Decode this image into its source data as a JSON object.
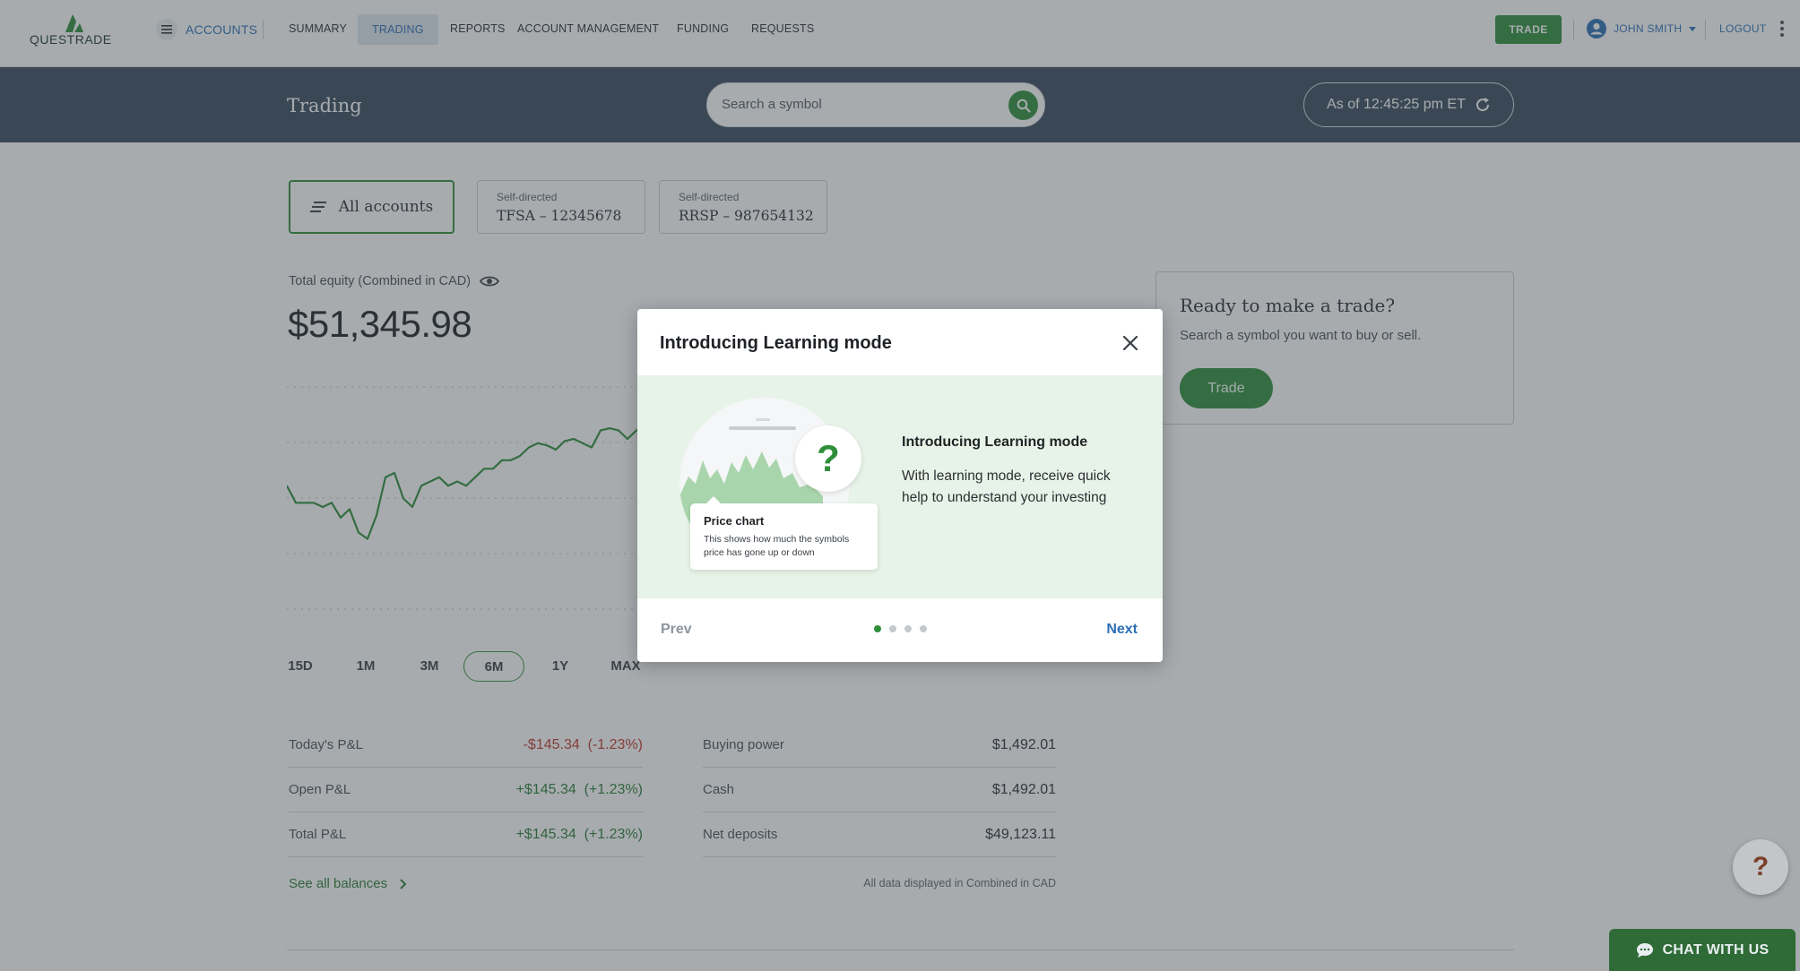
{
  "brand": {
    "logo_text": "QUESTRADE",
    "accent": "#2f8f3a",
    "link": "#2d6fb5",
    "header_bg": "#3a4b5d"
  },
  "nav": {
    "accounts": "ACCOUNTS",
    "items": [
      {
        "label": "SUMMARY"
      },
      {
        "label": "TRADING"
      },
      {
        "label": "REPORTS"
      },
      {
        "label": "ACCOUNT MANAGEMENT"
      },
      {
        "label": "FUNDING"
      },
      {
        "label": "REQUESTS"
      }
    ],
    "trade": "TRADE",
    "user": "JOHN SMITH",
    "logout": "LOGOUT"
  },
  "header": {
    "title": "Trading",
    "search_placeholder": "Search a symbol",
    "as_of": "As of 12:45:25 pm ET"
  },
  "accounts": {
    "all": "All accounts",
    "list": [
      {
        "type": "Self-directed",
        "name": "TFSA – 12345678"
      },
      {
        "type": "Self-directed",
        "name": "RRSP – 987654132"
      }
    ]
  },
  "equity": {
    "label": "Total equity (Combined in CAD)",
    "value": "$51,345.98"
  },
  "chart_data": {
    "type": "line",
    "values": [
      58,
      50,
      50,
      50,
      48,
      50,
      43,
      47,
      36,
      33,
      44,
      62,
      64,
      52,
      48,
      58,
      60,
      62,
      58,
      60,
      58,
      62,
      66,
      66,
      70,
      70,
      72,
      76,
      78,
      77,
      75,
      79,
      80,
      78,
      76,
      84,
      85,
      84,
      80,
      84,
      87,
      82,
      80
    ]
  },
  "ranges": [
    "15D",
    "1M",
    "3M",
    "6M",
    "1Y",
    "MAX"
  ],
  "pnl": [
    {
      "label": "Today's P&L",
      "value": "-$145.34  (-1.23%)",
      "tone": "neg"
    },
    {
      "label": "Open P&L",
      "value": "+$145.34  (+1.23%)",
      "tone": "pos"
    },
    {
      "label": "Total P&L",
      "value": "+$145.34  (+1.23%)",
      "tone": "pos"
    }
  ],
  "balances": [
    {
      "label": "Buying power",
      "value": "$1,492.01"
    },
    {
      "label": "Cash",
      "value": "$1,492.01"
    },
    {
      "label": "Net deposits",
      "value": "$49,123.11"
    }
  ],
  "see_all": "See all balances",
  "footnote": "All data displayed in Combined in CAD",
  "trade_card": {
    "title": "Ready to make a trade?",
    "subtitle": "Search a symbol you want to buy or sell.",
    "button": "Trade"
  },
  "modal": {
    "title": "Introducing Learning mode",
    "tooltip_title": "Price chart",
    "tooltip_body": "This shows how much the symbols price has gone up or down",
    "question_mark": "?",
    "heading": "Introducing Learning mode",
    "text": "With learning mode, receive quick help to understand your investing",
    "prev": "Prev",
    "next": "Next",
    "step": 1,
    "steps": 4
  },
  "help_fab": "?",
  "chat": "CHAT WITH US"
}
